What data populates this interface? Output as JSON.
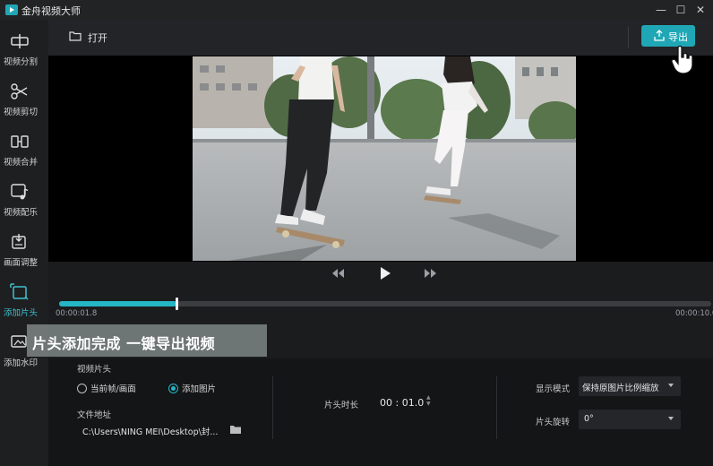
{
  "app": {
    "title": "金舟视频大师"
  },
  "window_controls": {
    "minimize": "—",
    "maximize": "☐",
    "close": "✕"
  },
  "sidebar": {
    "items": [
      {
        "label": "视频分割",
        "icon": "split-icon"
      },
      {
        "label": "视频剪切",
        "icon": "scissors-icon"
      },
      {
        "label": "视频合并",
        "icon": "merge-icon"
      },
      {
        "label": "视频配乐",
        "icon": "music-icon"
      },
      {
        "label": "画面调整",
        "icon": "adjust-icon"
      },
      {
        "label": "添加片头",
        "icon": "crop-icon",
        "active": true
      },
      {
        "label": "添加水印",
        "icon": "watermark-icon"
      }
    ]
  },
  "header": {
    "open_label": "打开",
    "export_label": "导出"
  },
  "player": {
    "progress_fraction": 0.18,
    "time_current": "00:00:01.8",
    "time_total": "00:00:10.0"
  },
  "caption": {
    "text": "片头添加完成 一键导出视频"
  },
  "panel": {
    "section_title": "视频片头",
    "radio_current_frame": "当前帧/画面",
    "radio_add_image": "添加图片",
    "selected": "添加图片",
    "file_label": "文件地址",
    "file_path": "C:\\Users\\NING MEI\\Desktop\\封...",
    "duration_label": "片头时长",
    "duration_value": "00 : 01.0",
    "display_mode_label": "显示模式",
    "display_mode_value": "保持原图片比例缩放",
    "rotation_label": "片头旋转",
    "rotation_value": "0°"
  },
  "colors": {
    "accent": "#1fa7b5",
    "progress": "#25b6c5",
    "background": "#1b1c1e"
  }
}
